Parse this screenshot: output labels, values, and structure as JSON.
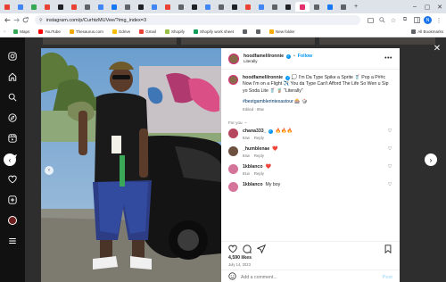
{
  "browser": {
    "tabs": [
      {
        "color": "#e94235"
      },
      {
        "color": "#4285f4"
      },
      {
        "color": "#34a853"
      },
      {
        "color": "#ea4335"
      },
      {
        "color": "#202124"
      },
      {
        "color": "#ea4335"
      },
      {
        "color": "#5f6368"
      },
      {
        "color": "#4285f4"
      },
      {
        "color": "#1877f2"
      },
      {
        "color": "#5f6368"
      },
      {
        "color": "#202124"
      },
      {
        "color": "#4285f4"
      },
      {
        "color": "#ea4335"
      },
      {
        "color": "#5f6368"
      },
      {
        "color": "#202124"
      },
      {
        "color": "#4285f4"
      },
      {
        "color": "#5f6368"
      },
      {
        "color": "#202124"
      },
      {
        "color": "#ea4335"
      },
      {
        "color": "#4285f4"
      },
      {
        "color": "#5f6368"
      },
      {
        "color": "#202124"
      },
      {
        "color": "#e1306c"
      },
      {
        "color": "#5f6368"
      },
      {
        "color": "#1877f2"
      },
      {
        "color": "#5f6368"
      }
    ],
    "url": "instagram.com/p/CurhtzMUVee/?img_index=3",
    "profile_initial": "N",
    "bookmarks": [
      {
        "label": "Maps",
        "color": "#34a853"
      },
      {
        "label": "YouTube",
        "color": "#ff0000"
      },
      {
        "label": "Thesaurus.com",
        "color": "#f2a900"
      },
      {
        "label": "Gdrive",
        "color": "#fbbc04"
      },
      {
        "label": "Gmail",
        "color": "#ea4335"
      },
      {
        "label": "Shopify",
        "color": "#96bf48"
      },
      {
        "label": "Shopify work sheet",
        "color": "#0f9d58"
      },
      {
        "label": "",
        "color": "#5f6368"
      },
      {
        "label": "",
        "color": "#5f6368"
      },
      {
        "label": "New folder",
        "color": "#f9ab00"
      }
    ],
    "all_bookmarks": "All Bookmarks"
  },
  "post": {
    "username": "hoodfamelilronnie",
    "follow_label": "Follow",
    "subtitle": "Literally",
    "caption": "💭 I'm Da Type Spike a Sprite 🥤 Pop a P##c Now I'm on a Flight ✈️ You da Type Can't Afford The Life So Wen u Sip yo Soda Lite 🥤 🧋 \"Literally\"",
    "hashtag": "#bestgamblerintexastour 🎰 🎲",
    "caption_meta": "Edited · 86w",
    "for_you_label": "For you",
    "comments": [
      {
        "user": "chana333_",
        "verified": true,
        "text": "🔥🔥🔥",
        "time": "84w",
        "reply": "Reply",
        "avatar_color": "#b5475f"
      },
      {
        "user": "_humblenae",
        "verified": false,
        "text": "❤️",
        "time": "84w",
        "reply": "Reply",
        "avatar_color": "#6d5040"
      },
      {
        "user": "1kblanco",
        "verified": false,
        "text": "❤️",
        "time": "81w",
        "reply": "Reply",
        "avatar_color": "#d4749a"
      },
      {
        "user": "1kblanco",
        "verified": false,
        "text": "My boy",
        "time": "",
        "reply": "",
        "avatar_color": "#d4749a"
      }
    ],
    "likes": "4,590 likes",
    "date": "July 14, 2023",
    "add_comment_placeholder": "Add a comment...",
    "post_button": "Post"
  },
  "icons": {
    "nav": [
      "instagram-icon",
      "home-icon",
      "search-icon",
      "explore-icon",
      "reels-icon",
      "messages-icon",
      "notifications-icon",
      "create-icon",
      "profile-icon",
      "menu-icon"
    ]
  },
  "colors": {
    "accent": "#0095f6",
    "like": "#ed4956"
  }
}
